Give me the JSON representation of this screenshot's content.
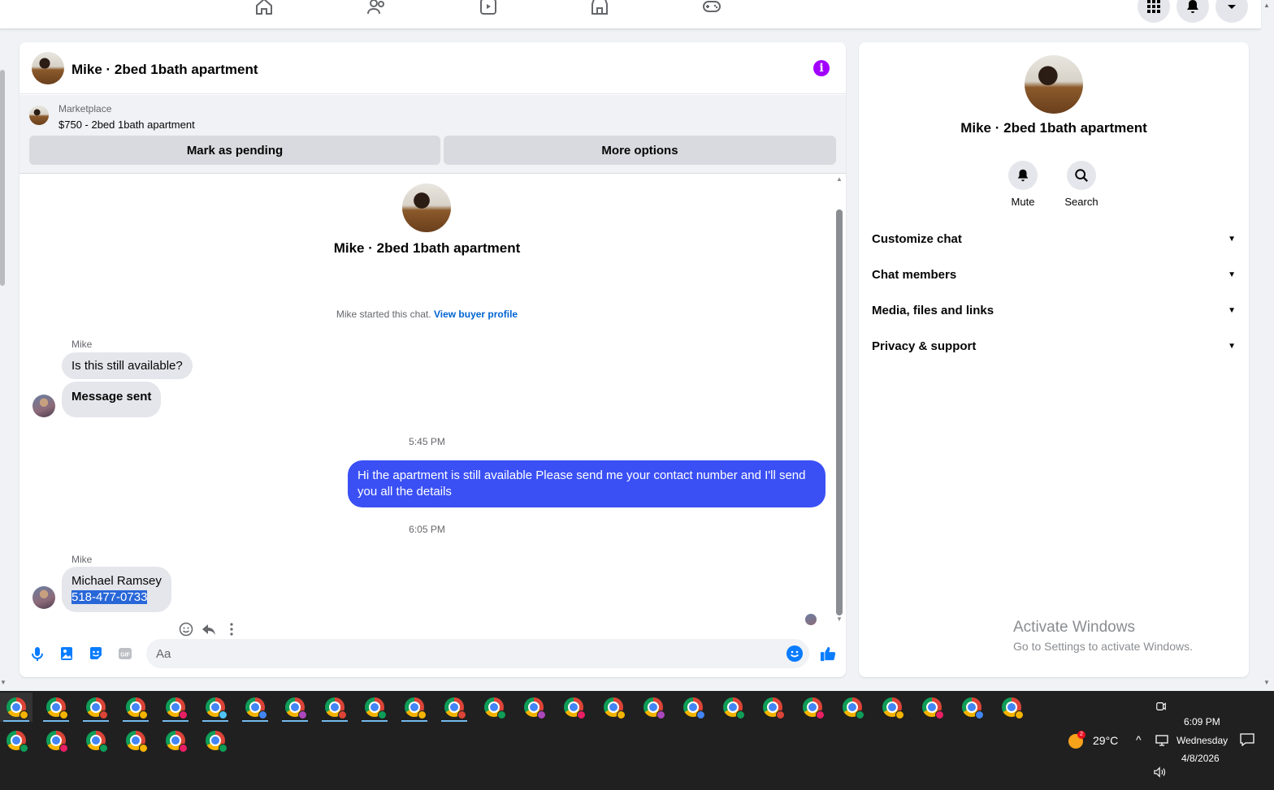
{
  "chat": {
    "title": "Mike · 2bed 1bath apartment",
    "marketplace": {
      "source": "Marketplace",
      "item": "$750 - 2bed 1bath apartment",
      "mark_pending": "Mark as pending",
      "more_options": "More options"
    },
    "intro_title": "Mike · 2bed 1bath apartment",
    "started_text": "Mike started this chat.",
    "view_buyer": "View buyer profile",
    "messages": [
      {
        "sender": "Mike",
        "text": "Is this still available?"
      },
      {
        "text": "Message sent"
      },
      {
        "time": "5:45 PM"
      },
      {
        "text": "Hi the apartment is still available Please send me your contact number and I'll send you all the details"
      },
      {
        "time": "6:05 PM"
      },
      {
        "sender": "Mike",
        "name_line": "Michael Ramsey",
        "phone": "518-477-0733"
      }
    ],
    "composer_placeholder": "Aa"
  },
  "info_panel": {
    "title": "Mike · 2bed 1bath apartment",
    "actions": [
      {
        "label": "Mute",
        "icon": "bell-icon"
      },
      {
        "label": "Search",
        "icon": "search-icon"
      }
    ],
    "sections": [
      "Customize chat",
      "Chat members",
      "Media, files and links",
      "Privacy & support"
    ]
  },
  "watermark": {
    "line1": "Activate Windows",
    "line2": "Go to Settings to activate Windows."
  },
  "taskbar": {
    "weather": "29°C",
    "weather_badge": "2",
    "time": "6:09 PM",
    "day": "Wednesday",
    "date": "4/8/2026"
  },
  "colors": {
    "accent": "#3a50f5",
    "link": "#0064d1",
    "info_icon": "#a100ff",
    "messenger_blue": "#0a7cff"
  }
}
